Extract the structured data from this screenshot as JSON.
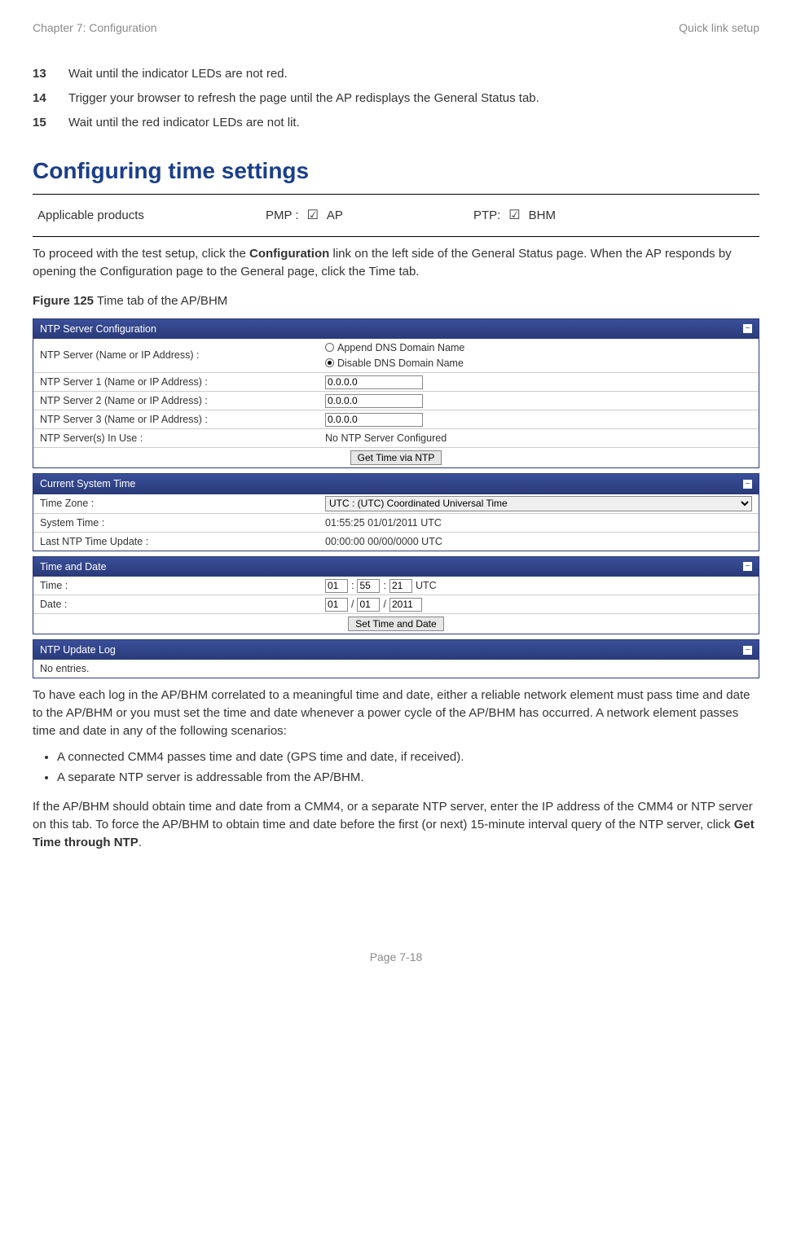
{
  "header": {
    "left": "Chapter 7:  Configuration",
    "right": "Quick link setup"
  },
  "steps": [
    {
      "n": "13",
      "t": "Wait until the indicator LEDs are not red."
    },
    {
      "n": "14",
      "t": "Trigger your browser to refresh the page until the AP redisplays the General Status tab."
    },
    {
      "n": "15",
      "t": "Wait until the red indicator LEDs are not lit."
    }
  ],
  "h2": "Configuring time settings",
  "applicable": {
    "label": "Applicable products",
    "pmp_label": "PMP :",
    "pmp_item": "AP",
    "ptp_label": "PTP:",
    "ptp_item": "BHM",
    "check": "☑"
  },
  "intro": {
    "pre": "To proceed with the test setup, click the ",
    "bold1": "Configuration",
    "post": " link on the left side of the General Status page. When the AP responds by opening the Configuration page to the General page, click the Time tab."
  },
  "figcap": {
    "bold": "Figure 125",
    "rest": " Time tab of the AP/BHM"
  },
  "ntp": {
    "title": "NTP Server Configuration",
    "dns_label": "NTP Server (Name or IP Address) :",
    "radio1": "Append DNS Domain Name",
    "radio2": "Disable DNS Domain Name",
    "s1_label": "NTP Server 1 (Name or IP Address) :",
    "s2_label": "NTP Server 2 (Name or IP Address) :",
    "s3_label": "NTP Server 3 (Name or IP Address) :",
    "s_val": "0.0.0.0",
    "inuse_label": "NTP Server(s) In Use :",
    "inuse_val": "No NTP Server Configured",
    "btn": "Get Time via NTP"
  },
  "cst": {
    "title": "Current System Time",
    "tz_label": "Time Zone :",
    "tz_val": "UTC : (UTC) Coordinated Universal Time",
    "st_label": "System Time :",
    "st_val": "01:55:25 01/01/2011 UTC",
    "lu_label": "Last NTP Time Update :",
    "lu_val": "00:00:00 00/00/0000 UTC"
  },
  "td": {
    "title": "Time and Date",
    "time_label": "Time :",
    "hh": "01",
    "mm": "55",
    "ss": "21",
    "tz": "UTC",
    "date_label": "Date :",
    "dd": "01",
    "mo": "01",
    "yy": "2011",
    "btn": "Set Time and Date"
  },
  "log": {
    "title": "NTP Update Log",
    "body": "No entries."
  },
  "para2": "To have each log in the AP/BHM correlated to a meaningful time and date, either a reliable network element must pass time and date to the AP/BHM or you must set the time and date whenever a power cycle of the AP/BHM has occurred. A network element passes time and date in any of the following scenarios:",
  "bullets": [
    "A connected CMM4 passes time and date (GPS time and date, if received).",
    "A separate NTP server is addressable from the AP/BHM."
  ],
  "para3": {
    "pre": "If the AP/BHM should obtain time and date from a CMM4, or a separate NTP server, enter the IP address of the CMM4 or NTP server on this tab. To force the AP/BHM to obtain time and date before the first (or next) 15-minute interval query of the NTP server, click ",
    "bold": "Get Time through NTP",
    "post": "."
  },
  "footer": "Page 7-18"
}
